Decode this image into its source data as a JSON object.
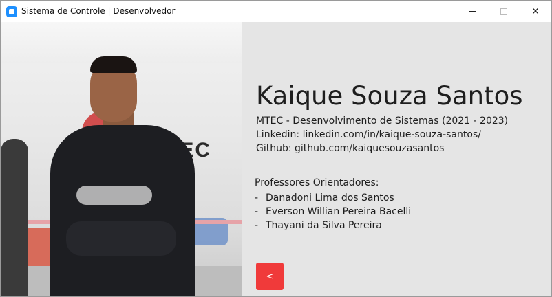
{
  "window": {
    "title": "Sistema de Controle | Desenvolvedor",
    "icons": {
      "app": "app-icon",
      "minimize": "minimize-icon",
      "maximize": "maximize-icon",
      "close": "close-icon"
    },
    "close_glyph": "✕"
  },
  "photo": {
    "wall_text": "TEC"
  },
  "profile": {
    "name": "Kaique Souza Santos",
    "course": "MTEC - Desenvolvimento de Sistemas (2021 - 2023)",
    "linkedin": "Linkedin: linkedin.com/in/kaique-souza-santos/",
    "github": "Github: github.com/kaiquesouzasantos"
  },
  "advisors": {
    "heading": "Professores Orientadores:",
    "bullet": "-",
    "items": [
      "Danadoni Lima dos Santos",
      "Everson Willian Pereira Bacelli",
      "Thayani da Silva Pereira"
    ]
  },
  "back_button": {
    "label": "<"
  },
  "colors": {
    "accent": "#f03a3a",
    "panel": "#e5e5e5",
    "app_icon": "#1e90ff"
  }
}
